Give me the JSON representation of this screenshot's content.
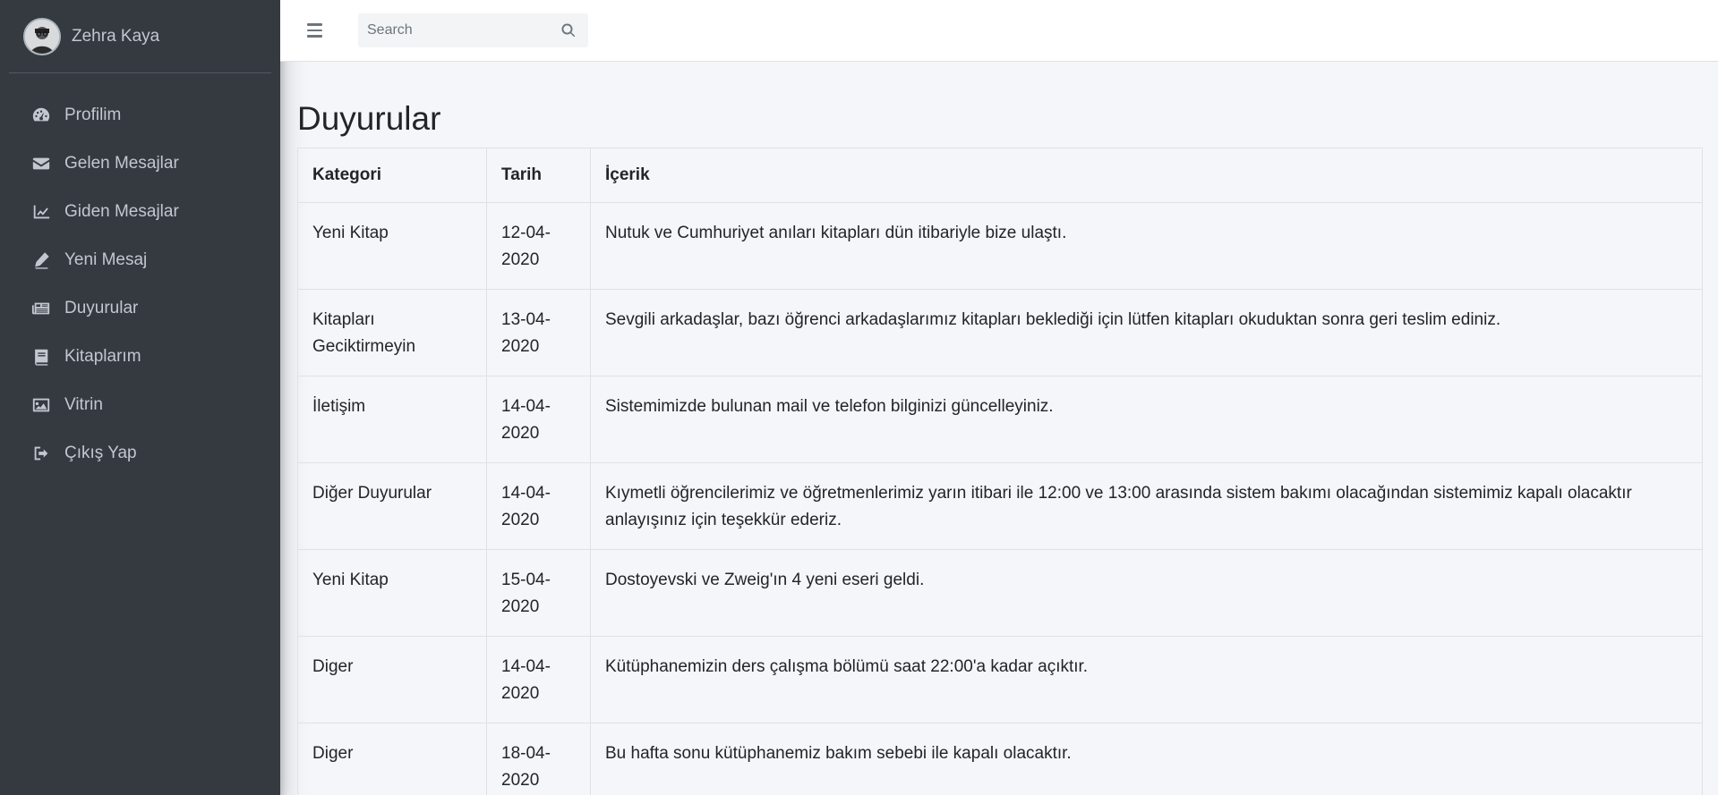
{
  "user": {
    "name": "Zehra Kaya"
  },
  "sidebar": {
    "items": [
      {
        "label": "Profilim",
        "icon": "tachometer-icon"
      },
      {
        "label": "Gelen Mesajlar",
        "icon": "envelope-icon"
      },
      {
        "label": "Giden Mesajlar",
        "icon": "chart-line-icon"
      },
      {
        "label": "Yeni Mesaj",
        "icon": "pen-icon"
      },
      {
        "label": "Duyurular",
        "icon": "newspaper-icon"
      },
      {
        "label": "Kitaplarım",
        "icon": "book-icon"
      },
      {
        "label": "Vitrin",
        "icon": "image-icon"
      },
      {
        "label": "Çıkış Yap",
        "icon": "sign-out-icon"
      }
    ]
  },
  "navbar": {
    "search_placeholder": "Search"
  },
  "main": {
    "title": "Duyurular",
    "table": {
      "headers": [
        "Kategori",
        "Tarih",
        "İçerik"
      ],
      "rows": [
        [
          "Yeni Kitap",
          "12-04-2020",
          "Nutuk ve Cumhuriyet anıları kitapları dün itibariyle bize ulaştı."
        ],
        [
          "Kitapları Geciktirmeyin",
          "13-04-2020",
          "Sevgili arkadaşlar, bazı öğrenci arkadaşlarımız kitapları beklediği için lütfen kitapları okuduktan sonra geri teslim ediniz."
        ],
        [
          "İletişim",
          "14-04-2020",
          "Sistemimizde bulunan mail ve telefon bilginizi güncelleyiniz."
        ],
        [
          "Diğer Duyurular",
          "14-04-2020",
          "Kıymetli öğrencilerimiz ve öğretmenlerimiz yarın itibari ile 12:00 ve 13:00 arasında sistem bakımı olacağından sistemimiz kapalı olacaktır anlayışınız için teşekkür ederiz."
        ],
        [
          "Yeni Kitap",
          "15-04-2020",
          "Dostoyevski ve Zweig'ın 4 yeni eseri geldi."
        ],
        [
          "Diger",
          "14-04-2020",
          "Kütüphanemizin ders çalışma bölümü saat 22:00'a kadar açıktır."
        ],
        [
          "Diger",
          "18-04-2020",
          "Bu hafta sonu kütüphanemiz bakım sebebi ile kapalı olacaktır."
        ]
      ]
    }
  },
  "colors": {
    "sidebar_bg": "#343a40",
    "sidebar_text": "#c2c7d0",
    "content_bg": "#f4f6f9"
  }
}
